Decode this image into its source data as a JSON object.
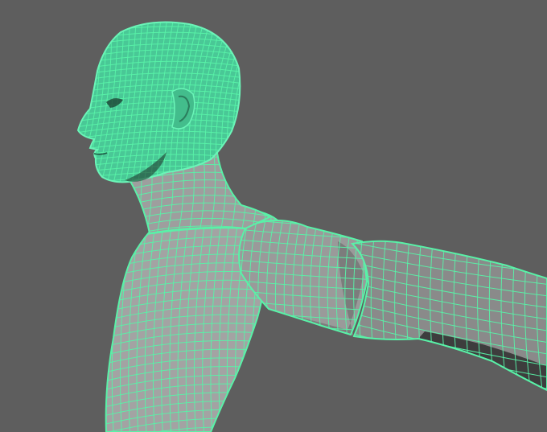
{
  "viewport": {
    "background": "#5e5e5e",
    "mode": "wireframe-on-shaded",
    "wire_color": "#59f2a8",
    "wire_fill": "#46c492",
    "shade_light": "#a8a8a8",
    "shade_mid": "#8f8f8f",
    "shade_dark": "#3d3d3d"
  },
  "model": {
    "selected": true,
    "parts": [
      "head-mesh",
      "ear-mesh",
      "neck-mesh",
      "torso-mesh",
      "shoulder-mesh",
      "upper-arm-mesh",
      "forearm-mesh"
    ]
  }
}
